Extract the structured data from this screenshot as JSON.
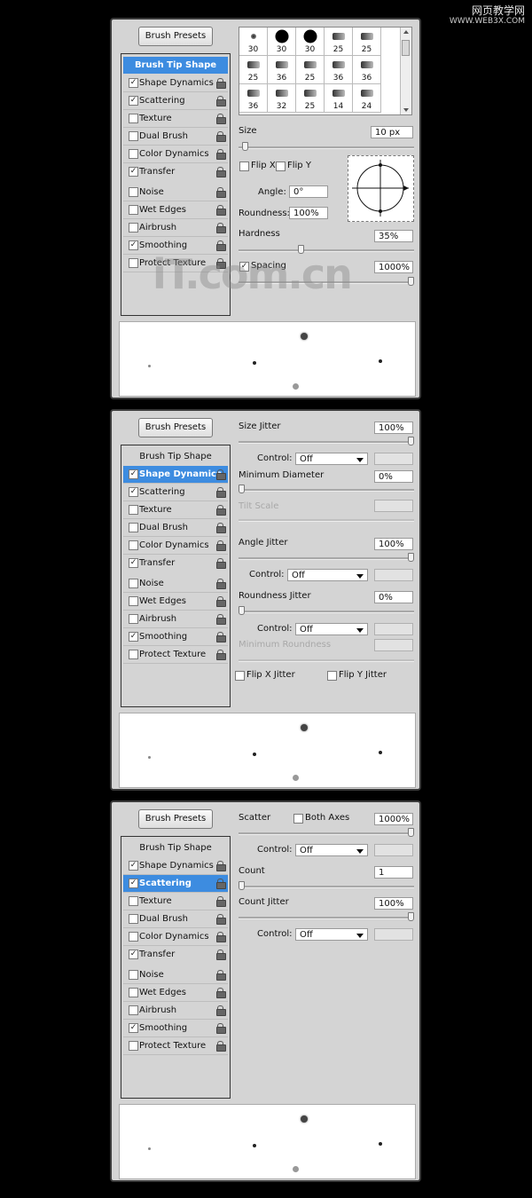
{
  "watermark": {
    "line1": "网页教学网",
    "line2": "WWW.WEB3X.COM"
  },
  "panel1": {
    "presets_button": "Brush Presets",
    "list": [
      {
        "label": "Brush Tip Shape",
        "checked": null,
        "selected": true
      },
      {
        "label": "Shape Dynamics",
        "checked": true
      },
      {
        "label": "Scattering",
        "checked": true
      },
      {
        "label": "Texture",
        "checked": false
      },
      {
        "label": "Dual Brush",
        "checked": false
      },
      {
        "label": "Color Dynamics",
        "checked": false
      },
      {
        "label": "Transfer",
        "checked": true
      },
      {
        "label": "Noise",
        "checked": false
      },
      {
        "label": "Wet Edges",
        "checked": false
      },
      {
        "label": "Airbrush",
        "checked": false
      },
      {
        "label": "Smoothing",
        "checked": true
      },
      {
        "label": "Protect Texture",
        "checked": false
      }
    ],
    "brushes": [
      "30",
      "30",
      "30",
      "25",
      "25",
      "25",
      "36",
      "25",
      "36",
      "36",
      "36",
      "32",
      "25",
      "14",
      "24"
    ],
    "size_label": "Size",
    "size_value": "10 px",
    "size_level": 0.02,
    "flip_x": "Flip X",
    "flip_y": "Flip Y",
    "angle_label": "Angle:",
    "angle_value": "0°",
    "roundness_label": "Roundness:",
    "roundness_value": "100%",
    "hardness_label": "Hardness",
    "hardness_value": "35%",
    "hardness_level": 0.35,
    "spacing_label": "Spacing",
    "spacing_value": "1000%",
    "spacing_level": 1.0,
    "watermark_logo": "iT.com.cn"
  },
  "panel2": {
    "presets_button": "Brush Presets",
    "list": [
      {
        "label": "Brush Tip Shape",
        "checked": null
      },
      {
        "label": "Shape Dynamics",
        "checked": true,
        "selected": true
      },
      {
        "label": "Scattering",
        "checked": true
      },
      {
        "label": "Texture",
        "checked": false
      },
      {
        "label": "Dual Brush",
        "checked": false
      },
      {
        "label": "Color Dynamics",
        "checked": false
      },
      {
        "label": "Transfer",
        "checked": true
      },
      {
        "label": "Noise",
        "checked": false
      },
      {
        "label": "Wet Edges",
        "checked": false
      },
      {
        "label": "Airbrush",
        "checked": false
      },
      {
        "label": "Smoothing",
        "checked": true
      },
      {
        "label": "Protect Texture",
        "checked": false
      }
    ],
    "size_jitter_label": "Size Jitter",
    "size_jitter_value": "100%",
    "size_jitter_level": 1.0,
    "control_label": "Control:",
    "control_value": "Off",
    "min_diameter_label": "Minimum Diameter",
    "min_diameter_value": "0%",
    "min_diameter_level": 0.0,
    "tilt_scale_label": "Tilt Scale",
    "angle_jitter_label": "Angle Jitter",
    "angle_jitter_value": "100%",
    "angle_jitter_level": 1.0,
    "roundness_jitter_label": "Roundness Jitter",
    "roundness_jitter_value": "0%",
    "roundness_jitter_level": 0.0,
    "min_roundness_label": "Minimum Roundness",
    "flip_x_jitter": "Flip X Jitter",
    "flip_y_jitter": "Flip Y Jitter"
  },
  "panel3": {
    "presets_button": "Brush Presets",
    "list": [
      {
        "label": "Brush Tip Shape",
        "checked": null
      },
      {
        "label": "Shape Dynamics",
        "checked": true
      },
      {
        "label": "Scattering",
        "checked": true,
        "selected": true
      },
      {
        "label": "Texture",
        "checked": false
      },
      {
        "label": "Dual Brush",
        "checked": false
      },
      {
        "label": "Color Dynamics",
        "checked": false
      },
      {
        "label": "Transfer",
        "checked": true
      },
      {
        "label": "Noise",
        "checked": false
      },
      {
        "label": "Wet Edges",
        "checked": false
      },
      {
        "label": "Airbrush",
        "checked": false
      },
      {
        "label": "Smoothing",
        "checked": true
      },
      {
        "label": "Protect Texture",
        "checked": false
      }
    ],
    "scatter_label": "Scatter",
    "both_axes": "Both Axes",
    "scatter_value": "1000%",
    "scatter_level": 1.0,
    "control_label": "Control:",
    "control_value": "Off",
    "count_label": "Count",
    "count_value": "1",
    "count_level": 0.0,
    "count_jitter_label": "Count Jitter",
    "count_jitter_value": "100%",
    "count_jitter_level": 1.0
  },
  "colors": {
    "selection": "#3d8ce0",
    "panel_bg": "#d4d4d4",
    "page_bg": "#000000"
  }
}
